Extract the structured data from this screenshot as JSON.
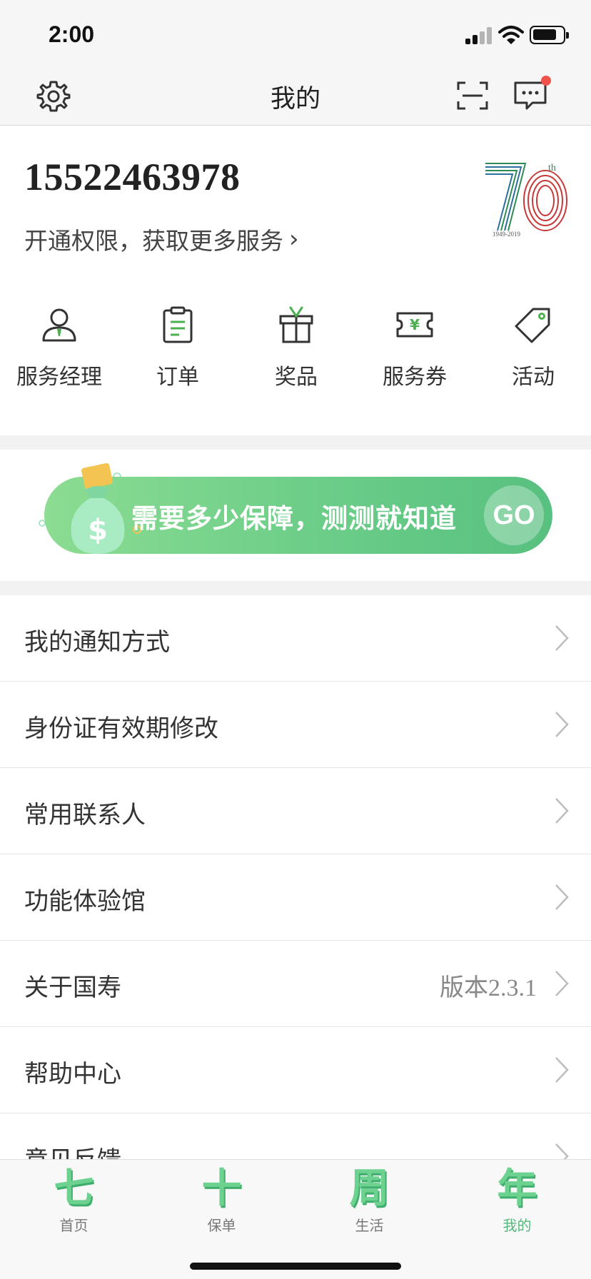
{
  "status_bar": {
    "time": "2:00"
  },
  "nav": {
    "title": "我的"
  },
  "profile": {
    "phone": "15522463978",
    "upgrade_text": "开通权限，获取更多服务",
    "anniversary_logo": {
      "number": "70",
      "superscript": "th",
      "years": "1949-2019"
    }
  },
  "quick_actions": [
    {
      "label": "服务经理",
      "icon": "service-manager-icon"
    },
    {
      "label": "订单",
      "icon": "order-clipboard-icon"
    },
    {
      "label": "奖品",
      "icon": "gift-icon"
    },
    {
      "label": "服务券",
      "icon": "coupon-ticket-icon"
    },
    {
      "label": "活动",
      "icon": "tag-icon"
    }
  ],
  "banner": {
    "text": "需要多少保障，测测就知道",
    "go": "GO"
  },
  "menu": [
    {
      "label": "我的通知方式",
      "value": ""
    },
    {
      "label": "身份证有效期修改",
      "value": ""
    },
    {
      "label": "常用联系人",
      "value": ""
    },
    {
      "label": "功能体验馆",
      "value": ""
    },
    {
      "label": "关于国寿",
      "value": "版本2.3.1"
    },
    {
      "label": "帮助中心",
      "value": ""
    },
    {
      "label": "意见反馈",
      "value": ""
    }
  ],
  "tabs": [
    {
      "icon_text": "七",
      "label": "首页",
      "active": false
    },
    {
      "icon_text": "十",
      "label": "保单",
      "active": false
    },
    {
      "icon_text": "周",
      "label": "生活",
      "active": false
    },
    {
      "icon_text": "年",
      "label": "我的",
      "active": true
    }
  ],
  "colors": {
    "accent_green": "#6bcd88",
    "badge_red": "#f0524c",
    "text_dark": "#333333"
  }
}
